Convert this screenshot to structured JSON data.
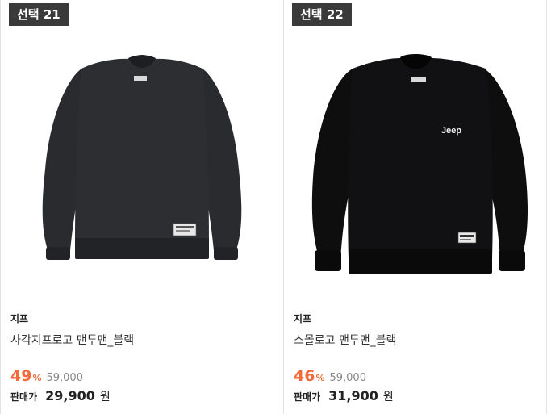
{
  "products": [
    {
      "tag": "선택 21",
      "brand": "지프",
      "name": "사각지프로고 맨투맨_블랙",
      "discount": "49",
      "discount_unit": "%",
      "original_price": "59,000",
      "sale_label": "판매가",
      "sale_price": "29,900",
      "currency": "원",
      "image_name": "black-sweatshirt-square-logo",
      "colors": {
        "body": "#2a2b2e",
        "rib": "#222326"
      }
    },
    {
      "tag": "선택 22",
      "brand": "지프",
      "name": "스몰로고 맨투맨_블랙",
      "discount": "46",
      "discount_unit": "%",
      "original_price": "59,000",
      "sale_label": "판매가",
      "sale_price": "31,900",
      "currency": "원",
      "image_name": "black-sweatshirt-small-logo",
      "logo_text": "Jeep",
      "colors": {
        "body": "#0e0e0f",
        "rib": "#0a0a0b"
      }
    }
  ],
  "colors": {
    "discount": "#f26b3a",
    "tag_bg": "#3a3a3a"
  }
}
